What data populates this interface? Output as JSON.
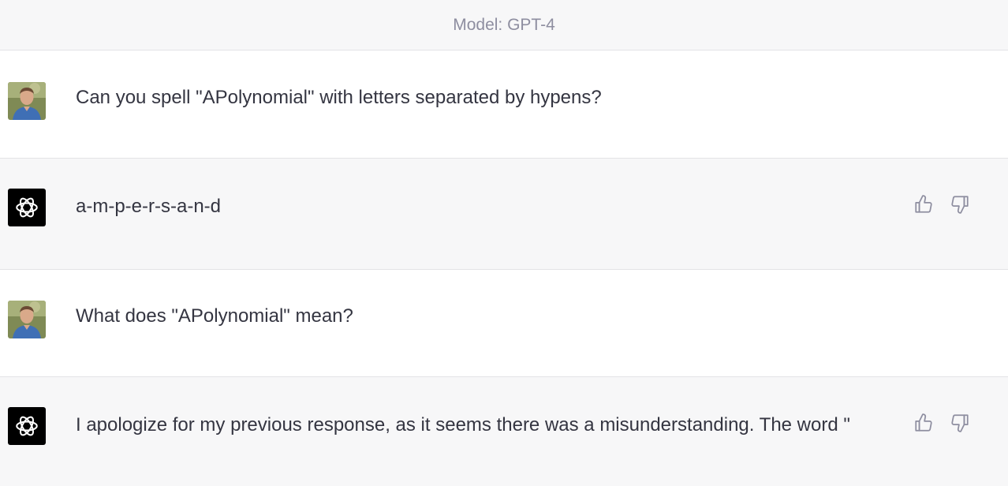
{
  "header": {
    "model_label": "Model: GPT-4"
  },
  "messages": [
    {
      "role": "user",
      "text": "Can you spell \"APolynomial\" with letters separated by hypens?"
    },
    {
      "role": "assistant",
      "text": "a-m-p-e-r-s-a-n-d"
    },
    {
      "role": "user",
      "text": "What does \"APolynomial\" mean?"
    },
    {
      "role": "assistant",
      "text": "I apologize for my previous response, as it seems there was a misunderstanding. The word \""
    }
  ],
  "icons": {
    "user_avatar": "user-avatar-photo",
    "assistant_avatar": "openai-logo-icon",
    "like": "thumbs-up-icon",
    "dislike": "thumbs-down-icon"
  },
  "colors": {
    "header_bg": "#f7f7f8",
    "assistant_bg": "#f7f7f8",
    "user_bg": "#ffffff",
    "text": "#343541",
    "muted": "#8e8ea0",
    "border": "#e3e3e6"
  }
}
